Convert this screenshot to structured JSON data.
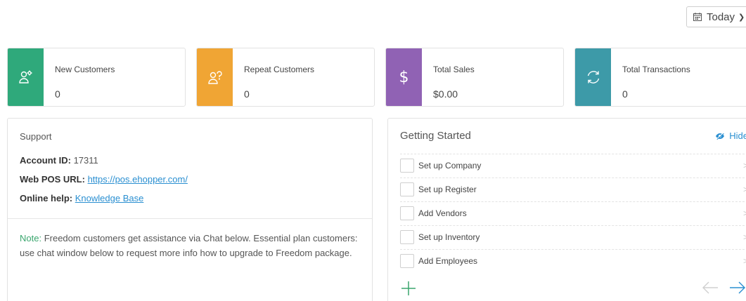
{
  "date_filter": {
    "label": "Today",
    "icon": "calendar-icon"
  },
  "stats": [
    {
      "label": "New Customers",
      "value": "0",
      "color": "#2fa97b",
      "icon": "new-customers-icon"
    },
    {
      "label": "Repeat Customers",
      "value": "0",
      "color": "#f0a534",
      "icon": "repeat-customers-icon"
    },
    {
      "label": "Total Sales",
      "value": "$0.00",
      "color": "#9062b4",
      "icon": "dollar-icon"
    },
    {
      "label": "Total Transactions",
      "value": "0",
      "color": "#3d9aa8",
      "icon": "sync-icon"
    }
  ],
  "support": {
    "title": "Support",
    "account_label": "Account ID:",
    "account_value": "17311",
    "webpos_label": "Web POS URL:",
    "webpos_link": "https://pos.ehopper.com/",
    "help_label": "Online help:",
    "help_link": "Knowledge Base",
    "note_prefix": "Note:",
    "note_text": "Freedom customers get assistance via Chat below. Essential plan customers: use chat window below to request more info how to upgrade to Freedom package."
  },
  "getting_started": {
    "title": "Getting Started",
    "hide_label": "Hide",
    "tasks": [
      "Set up Company",
      "Set up Register",
      "Add Vendors",
      "Set up Inventory",
      "Add Employees"
    ]
  },
  "colors": {
    "link": "#2a8fd1",
    "accent_green": "#3aa66e"
  }
}
